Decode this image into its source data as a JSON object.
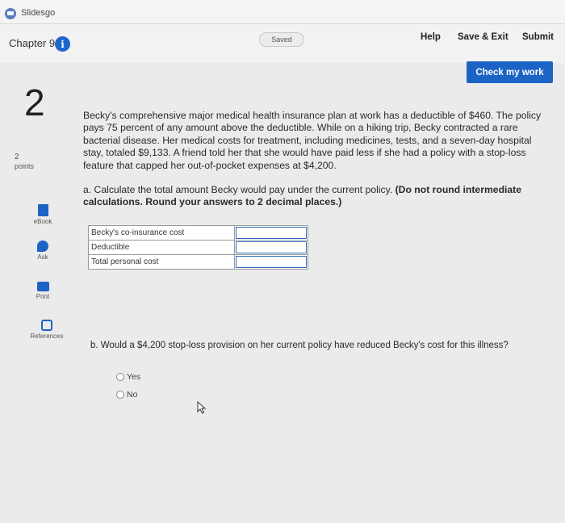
{
  "tab": {
    "title": "Slidesgo",
    "icon": "slidesgo-icon"
  },
  "header": {
    "chapter": "Chapter 9",
    "status": "Saved",
    "help": "Help",
    "save_exit": "Save & Exit",
    "submit": "Submit",
    "check_my_work": "Check my work"
  },
  "question": {
    "number": "2",
    "points_value": "2",
    "points_label": "points",
    "text": "Becky's comprehensive major medical health insurance plan at work has a deductible of $460. The policy pays 75 percent of any amount above the deductible. While on a hiking trip, Becky contracted a rare bacterial disease. Her medical costs for treatment, including medicines, tests, and a seven-day hospital stay, totaled $9,133. A friend told her that she would have paid less if she had a policy with a stop-loss feature that capped her out-of-pocket expenses at $4,200.",
    "part_a_text": "a. Calculate the total amount Becky would pay under the current policy.",
    "part_a_instructions": "(Do not round intermediate calculations. Round your answers to 2 decimal places.)",
    "table_rows": [
      {
        "label": "Becky's co-insurance cost",
        "value": ""
      },
      {
        "label": "Deductible",
        "value": ""
      },
      {
        "label": "Total personal cost",
        "value": ""
      }
    ],
    "part_b_text": "b. Would a $4,200 stop-loss provision on her current policy have reduced Becky's cost for this illness?",
    "options": [
      "Yes",
      "No"
    ]
  },
  "sidebar": {
    "items": [
      {
        "label": "eBook",
        "icon": "ebook-icon"
      },
      {
        "label": "Ask",
        "icon": "ask-icon"
      },
      {
        "label": "Print",
        "icon": "print-icon"
      },
      {
        "label": "References",
        "icon": "references-icon"
      }
    ]
  },
  "colors": {
    "accent": "#1c63c6",
    "background": "#ebebeb"
  }
}
